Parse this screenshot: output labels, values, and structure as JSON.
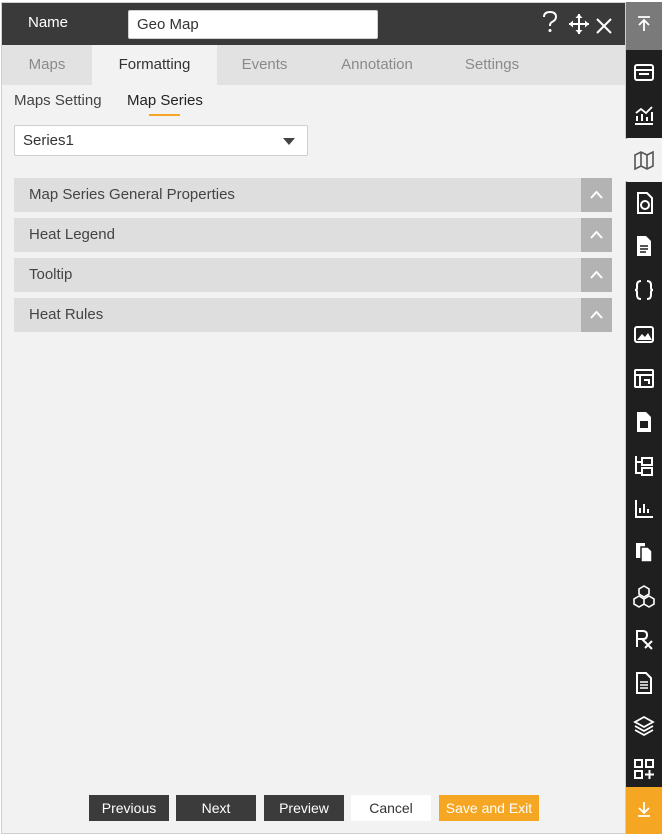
{
  "header": {
    "name_label": "Name",
    "name_value": "Geo Map",
    "help_icon": "question-icon",
    "move_icon": "move-icon",
    "close_icon": "close-icon"
  },
  "tabs": [
    {
      "label": "Maps"
    },
    {
      "label": "Formatting"
    },
    {
      "label": "Events"
    },
    {
      "label": "Annotation"
    },
    {
      "label": "Settings"
    }
  ],
  "active_tab": "Formatting",
  "subtabs": [
    {
      "label": "Maps Setting"
    },
    {
      "label": "Map Series"
    }
  ],
  "active_subtab": "Map Series",
  "series_select": {
    "value": "Series1"
  },
  "accordions": [
    {
      "label": "Map Series General Properties"
    },
    {
      "label": "Heat Legend"
    },
    {
      "label": "Tooltip"
    },
    {
      "label": "Heat Rules"
    }
  ],
  "footer": {
    "previous": "Previous",
    "next": "Next",
    "preview": "Preview",
    "cancel": "Cancel",
    "save_exit": "Save and Exit"
  },
  "rail": {
    "top_icon": "scroll-top-icon",
    "bottom_icon": "scroll-bottom-icon",
    "icons": [
      "table-icon",
      "line-chart-icon",
      "map-icon",
      "pie-report-icon",
      "document-icon",
      "code-braces-icon",
      "image-icon",
      "calendar-icon",
      "calculator-icon",
      "tree-icon",
      "bar-axis-icon",
      "copy-icon",
      "cubes-icon",
      "rx-icon",
      "list-doc-icon",
      "layers-icon",
      "add-grid-icon"
    ],
    "active_icon": "map-icon"
  },
  "colors": {
    "accent": "#f5a623",
    "header_bg": "#3a3a3a",
    "rail_bg": "#1f1f1f"
  }
}
